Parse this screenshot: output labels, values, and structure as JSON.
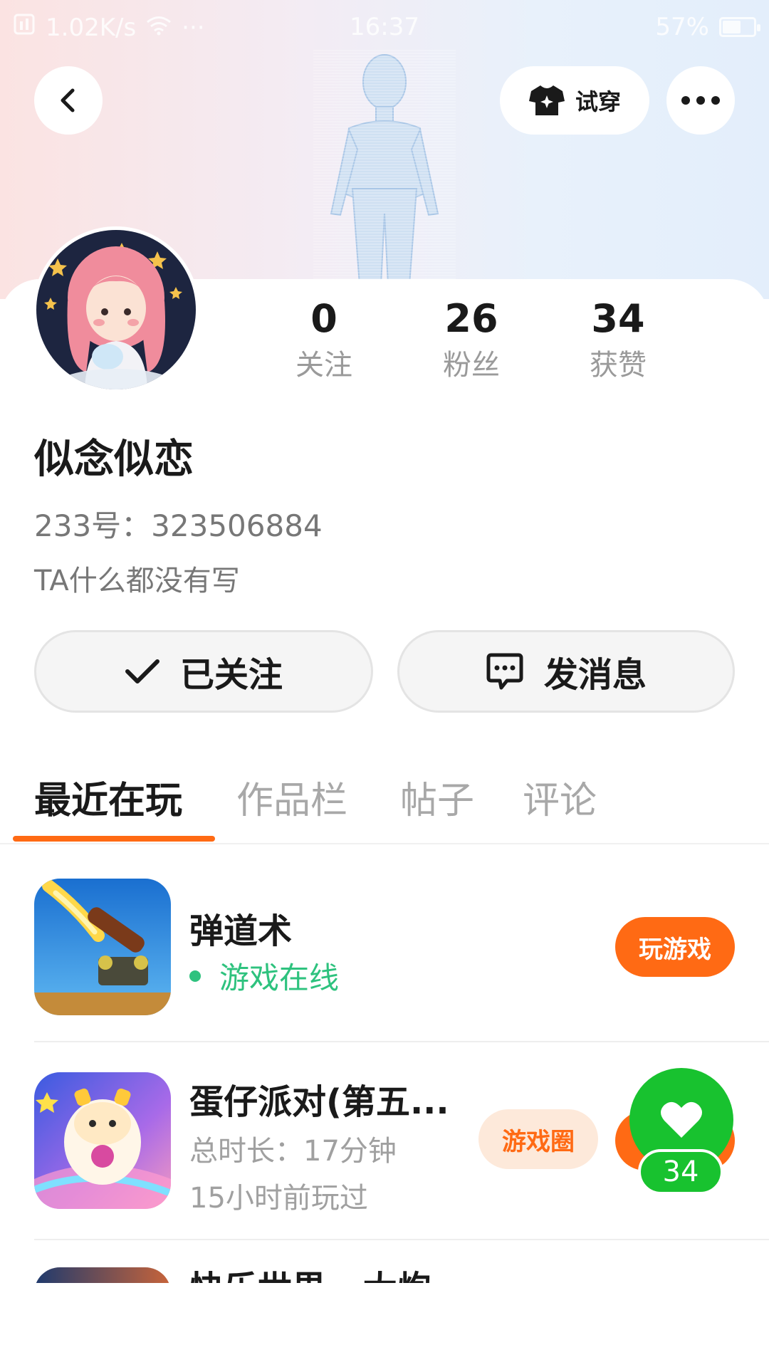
{
  "status_bar": {
    "network_speed": "1.02K/s",
    "more": "···",
    "time": "16:37",
    "battery": "57%"
  },
  "header": {
    "tryon_label": "试穿"
  },
  "profile": {
    "nickname": "似念似恋",
    "uid_label": "233号：",
    "uid": "323506884",
    "bio": "TA什么都没有写"
  },
  "stats": [
    {
      "value": "0",
      "label": "关注"
    },
    {
      "value": "26",
      "label": "粉丝"
    },
    {
      "value": "34",
      "label": "获赞"
    }
  ],
  "actions": {
    "follow_label": "已关注",
    "message_label": "发消息"
  },
  "tabs": [
    {
      "label": "最近在玩",
      "active": true
    },
    {
      "label": "作品栏"
    },
    {
      "label": "帖子"
    },
    {
      "label": "评论"
    }
  ],
  "games": [
    {
      "title": "弹道术",
      "status": "游戏在线",
      "button": "玩游戏"
    },
    {
      "title": "蛋仔派对(第五...",
      "duration": "总时长：17分钟",
      "last_played": "15小时前玩过",
      "chip": "游戏圈"
    },
    {
      "title": "快乐世界 · 大炮"
    }
  ],
  "like_widget": {
    "count": "34"
  },
  "colors": {
    "accent": "#ff6a14",
    "online": "#2ec27e",
    "like_green": "#18c22f"
  }
}
